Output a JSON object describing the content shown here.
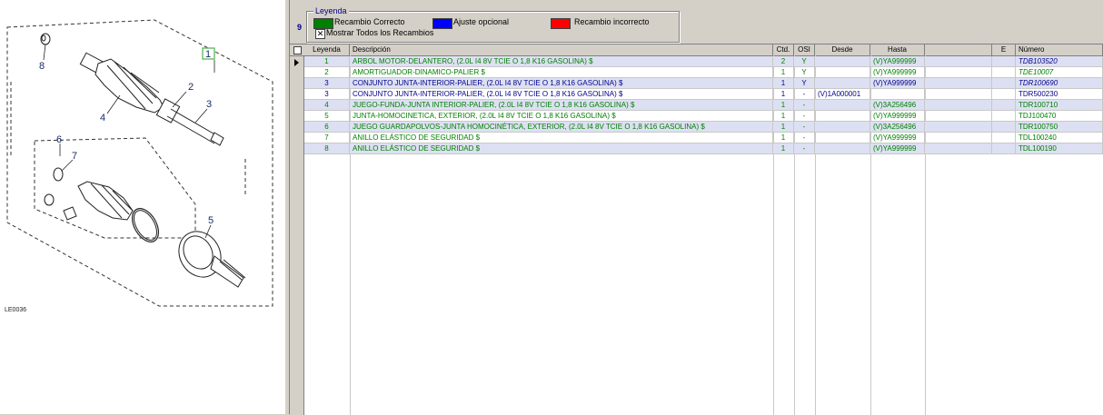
{
  "diagram": {
    "code": "LE0036",
    "callouts": [
      "1",
      "2",
      "3",
      "4",
      "5",
      "6",
      "7",
      "8"
    ]
  },
  "legend": {
    "count": "9",
    "title": "Leyenda",
    "items": [
      {
        "label": "Recambio Correcto",
        "color": "#008000"
      },
      {
        "label": "Ajuste opcional",
        "color": "#0000ff"
      },
      {
        "label": "Recambio incorrecto",
        "color": "#ff0000"
      }
    ],
    "show_all_label": "Mostrar Todos los Recambios",
    "show_all_checked": "✕"
  },
  "table": {
    "headers": [
      "Leyenda",
      "Descripción",
      "Ctd.",
      "OSI",
      "Desde",
      "Hasta",
      "",
      "E",
      "Número"
    ],
    "rows": [
      {
        "leyenda": "1",
        "descripcion": "ARBOL MOTOR-DELANTERO, (2.0L I4 8V TCIE O 1,8 K16 GASOLINA) $",
        "ctd": "2",
        "osi": "Y",
        "desde": "",
        "hasta": "(V)YA999999",
        "e": "",
        "numero": "TDB103520",
        "color": "#008000",
        "numero_color": "#00008b",
        "italic": true
      },
      {
        "leyenda": "2",
        "descripcion": "AMORTIGUADOR-DINAMICO-PALIER $",
        "ctd": "1",
        "osi": "Y",
        "desde": "",
        "hasta": "(V)YA999999",
        "e": "",
        "numero": "TDE10007",
        "color": "#008000",
        "numero_color": "#008000",
        "italic": true
      },
      {
        "leyenda": "3",
        "descripcion": "CONJUNTO JUNTA-INTERIOR-PALIER, (2.0L I4 8V TCIE O 1,8 K16 GASOLINA) $",
        "ctd": "1",
        "osi": "Y",
        "desde": "",
        "hasta": "(V)YA999999",
        "e": "",
        "numero": "TDR100690",
        "color": "#00008b",
        "numero_color": "#00008b",
        "italic": true
      },
      {
        "leyenda": "3",
        "descripcion": "CONJUNTO JUNTA-INTERIOR-PALIER, (2.0L I4 8V TCIE O 1,8 K16 GASOLINA) $",
        "ctd": "1",
        "osi": "-",
        "desde": "(V)1A000001",
        "hasta": "",
        "e": "",
        "numero": "TDR500230",
        "color": "#00008b",
        "numero_color": "#00008b",
        "italic": false
      },
      {
        "leyenda": "4",
        "descripcion": "JUEGO-FUNDA-JUNTA INTERIOR-PALIER, (2.0L I4 8V TCIE O 1,8 K16 GASOLINA) $",
        "ctd": "1",
        "osi": "-",
        "desde": "",
        "hasta": "(V)3A256496",
        "e": "",
        "numero": "TDR100710",
        "color": "#008000",
        "numero_color": "#008000",
        "italic": false
      },
      {
        "leyenda": "5",
        "descripcion": "JUNTA-HOMOCINETICA, EXTERIOR, (2.0L I4 8V TCIE O 1,8 K16 GASOLINA) $",
        "ctd": "1",
        "osi": "-",
        "desde": "",
        "hasta": "(V)YA999999",
        "e": "",
        "numero": "TDJ100470",
        "color": "#008000",
        "numero_color": "#008000",
        "italic": false
      },
      {
        "leyenda": "6",
        "descripcion": "JUEGO GUARDAPOLVOS-JUNTA HOMOCINÉTICA, EXTERIOR, (2.0L I4 8V TCIE O 1,8 K16 GASOLINA) $",
        "ctd": "1",
        "osi": "-",
        "desde": "",
        "hasta": "(V)3A256496",
        "e": "",
        "numero": "TDR100750",
        "color": "#008000",
        "numero_color": "#008000",
        "italic": false
      },
      {
        "leyenda": "7",
        "descripcion": "ANILLO ELÁSTICO DE SEGURIDAD $",
        "ctd": "1",
        "osi": "-",
        "desde": "",
        "hasta": "(V)YA999999",
        "e": "",
        "numero": "TDL100240",
        "color": "#008000",
        "numero_color": "#008000",
        "italic": false
      },
      {
        "leyenda": "8",
        "descripcion": "ANILLO ELÁSTICO DE SEGURIDAD $",
        "ctd": "1",
        "osi": "-",
        "desde": "",
        "hasta": "(V)YA999999",
        "e": "",
        "numero": "TDL100190",
        "color": "#008000",
        "numero_color": "#008000",
        "italic": false
      }
    ]
  }
}
